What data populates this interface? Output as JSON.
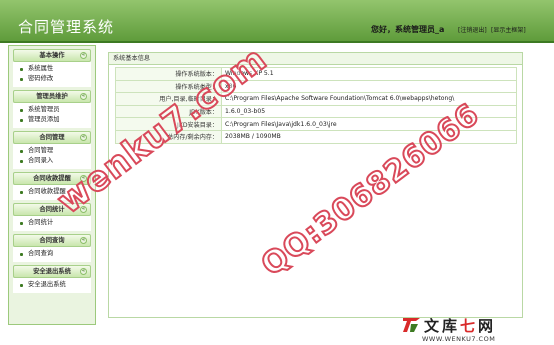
{
  "header": {
    "title": "合同管理系统",
    "greeting": "您好，系统管理员_a",
    "logout_link": "[注销退出]",
    "home_link": "[显示主框架]"
  },
  "sidebar": {
    "sections": [
      {
        "title": "基本操作",
        "items": [
          "系统属性",
          "密码修改"
        ]
      },
      {
        "title": "管理员维护",
        "items": [
          "系统管理员",
          "管理员添加"
        ]
      },
      {
        "title": "合同管理",
        "items": [
          "合同管理",
          "合同录入"
        ]
      },
      {
        "title": "合同收款提醒",
        "items": [
          "合同收款提醒"
        ]
      },
      {
        "title": "合同统计",
        "items": [
          "合同统计"
        ]
      },
      {
        "title": "合同查询",
        "items": [
          "合同查询"
        ]
      },
      {
        "title": "安全退出系统",
        "items": [
          "安全退出系统"
        ]
      }
    ]
  },
  "panel": {
    "title": "系统基本信息",
    "rows": [
      {
        "label": "操作系统版本：",
        "value": "Windows XP  5.1"
      },
      {
        "label": "操作系统类型：",
        "value": "x86"
      },
      {
        "label": "用户,目录,临时目录：",
        "value": "C:\\Program Files\\Apache Software Foundation\\Tomcat 6.0\\webapps\\hetong\\"
      },
      {
        "label": "JDK版本：",
        "value": "1.6.0_03-b05"
      },
      {
        "label": "JKD安装目录：",
        "value": "C:\\Program Files\\Java\\jdk1.6.0_03\\jre"
      },
      {
        "label": "总内存/剩余内存：",
        "value": "2038MB / 1090MB"
      }
    ]
  },
  "watermarks": {
    "site": "wenku7.com",
    "qq": "QQ:306826066"
  },
  "logo": {
    "text_prefix": "文库",
    "text_accent": "七",
    "text_suffix": "网",
    "url": "WWW.WENKU7.COM"
  }
}
